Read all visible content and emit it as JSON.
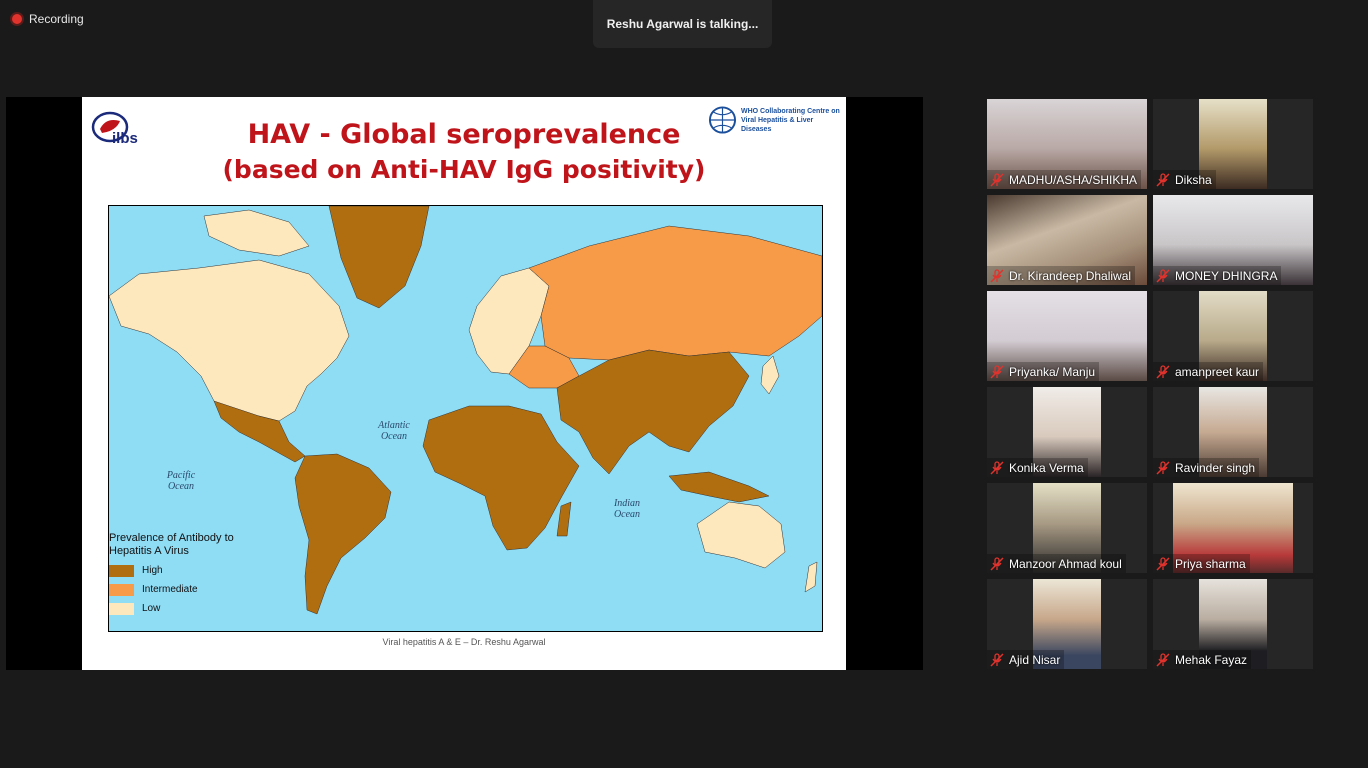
{
  "recording": {
    "label": "Recording"
  },
  "talking": {
    "text": "Reshu Agarwal is talking..."
  },
  "slide": {
    "title_line1": "HAV - Global seroprevalence",
    "title_line2": "(based on  Anti-HAV IgG  positivity)",
    "logo_text": "ilbs",
    "who_line1": "WHO Collaborating Centre on",
    "who_line2": "Viral Hepatitis & Liver Diseases",
    "oceans": {
      "atlantic": "Atlantic Ocean",
      "pacific": "Pacific Ocean",
      "indian": "Indian Ocean"
    },
    "legend": {
      "title": "Prevalence of Antibody to Hepatitis A Virus",
      "items": [
        {
          "label": "High",
          "color": "#b06e10"
        },
        {
          "label": "Intermediate",
          "color": "#f79b48"
        },
        {
          "label": "Low",
          "color": "#fde7bc"
        }
      ]
    },
    "footer": "Viral hepatitis A & E – Dr. Reshu Agarwal"
  },
  "participants": [
    {
      "name": "MADHU/ASHA/SHIKHA",
      "muted": true
    },
    {
      "name": "Diksha",
      "muted": true
    },
    {
      "name": "Dr. Kirandeep Dhaliwal",
      "muted": true
    },
    {
      "name": "MONEY DHINGRA",
      "muted": true
    },
    {
      "name": "Priyanka/ Manju",
      "muted": true
    },
    {
      "name": "amanpreet kaur",
      "muted": true
    },
    {
      "name": "Konika Verma",
      "muted": true
    },
    {
      "name": "Ravinder singh",
      "muted": true
    },
    {
      "name": "Manzoor Ahmad koul",
      "muted": true
    },
    {
      "name": "Priya sharma",
      "muted": true
    },
    {
      "name": "Ajid Nisar",
      "muted": true
    },
    {
      "name": "Mehak Fayaz",
      "muted": true
    }
  ]
}
